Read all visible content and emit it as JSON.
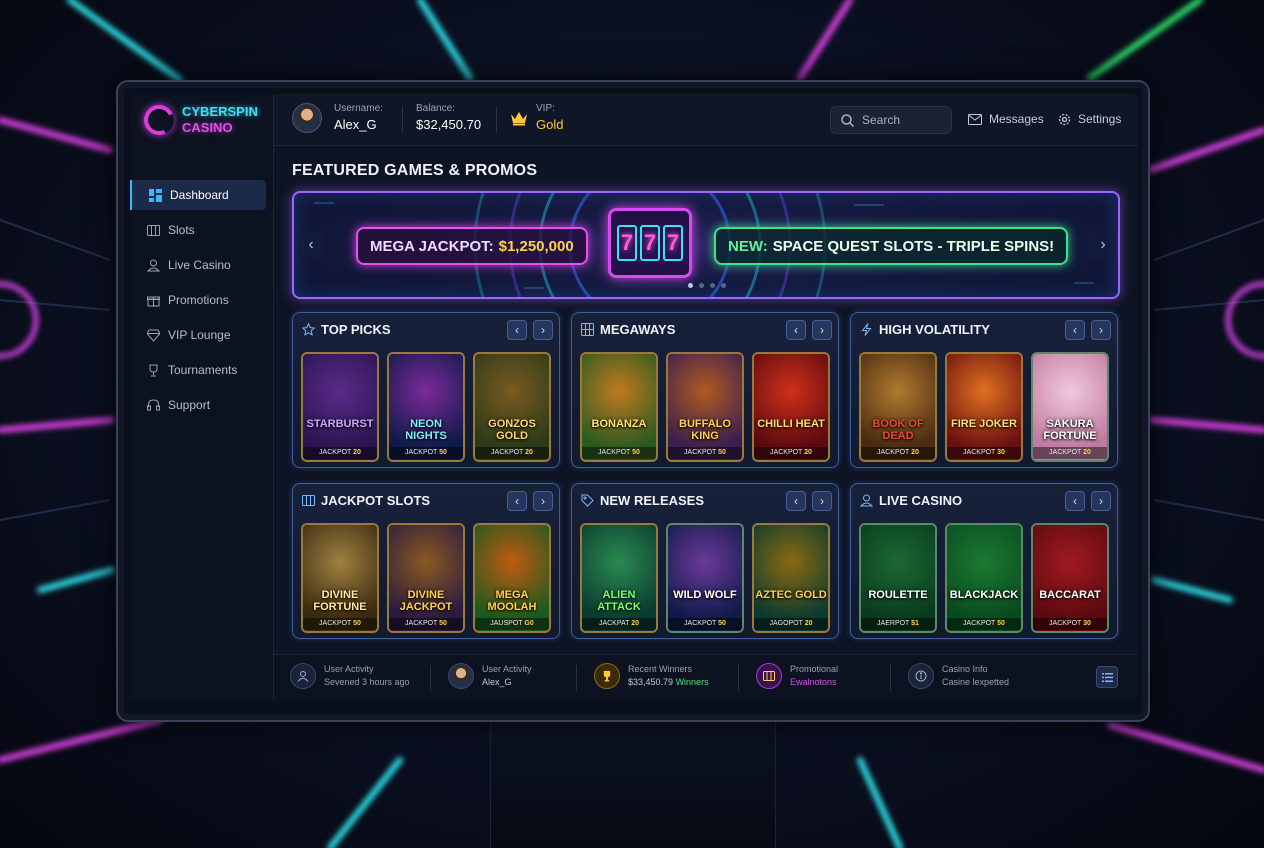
{
  "brand": {
    "line1": "CYBERSPIN",
    "line2": "CASINO"
  },
  "header": {
    "username_label": "Username:",
    "username": "Alex_G",
    "balance_label": "Balance:",
    "balance": "$32,450.70",
    "vip_label": "VIP:",
    "vip_level": "Gold",
    "search_placeholder": "Search",
    "messages_label": "Messages",
    "settings_label": "Settings"
  },
  "sidebar": {
    "items": [
      {
        "label": "Dashboard",
        "icon": "grid-icon",
        "active": true
      },
      {
        "label": "Slots",
        "icon": "slot-machine-icon"
      },
      {
        "label": "Live Casino",
        "icon": "dealer-icon"
      },
      {
        "label": "Promotions",
        "icon": "gift-icon"
      },
      {
        "label": "VIP Lounge",
        "icon": "diamond-icon"
      },
      {
        "label": "Tournaments",
        "icon": "trophy-icon"
      },
      {
        "label": "Support",
        "icon": "headset-icon"
      }
    ]
  },
  "featured": {
    "title": "FEATURED GAMES & PROMOS",
    "promo1_text": "MEGA JACKPOT:",
    "promo1_amount": "$1,250,000",
    "promo2_prefix": "NEW:",
    "promo2_text": "SPACE QUEST SLOTS - TRIPLE SPINS!",
    "slot_digits": [
      "7",
      "7",
      "7"
    ]
  },
  "panels": [
    {
      "title": "TOP PICKS",
      "icon": "star-icon",
      "games": [
        {
          "name": "STARBURST",
          "jackpot_label": "JACKPOT",
          "jackpot": "20",
          "colors": [
            "#2a1550",
            "#5a2a8a"
          ],
          "title_color": "#c8a8ff"
        },
        {
          "name": "NEON NIGHTS",
          "jackpot_label": "JACKPOT",
          "jackpot": "50",
          "colors": [
            "#101a48",
            "#7a2a9a"
          ],
          "title_color": "#7ef0ff"
        },
        {
          "name": "GONZOS GOLD",
          "jackpot_label": "JACKPOT",
          "jackpot": "20",
          "colors": [
            "#2a3a18",
            "#7a5a20"
          ],
          "title_color": "#ffd86a"
        }
      ]
    },
    {
      "title": "MEGAWAYS",
      "icon": "grid-icon",
      "games": [
        {
          "name": "BONANZA",
          "jackpot_label": "JACKPOT",
          "jackpot": "50",
          "colors": [
            "#2a5a20",
            "#c07a20"
          ],
          "title_color": "#ffe070"
        },
        {
          "name": "BUFFALO KING",
          "jackpot_label": "JACKPOT",
          "jackpot": "50",
          "colors": [
            "#3a1e50",
            "#b05a20"
          ],
          "title_color": "#ffd24a"
        },
        {
          "name": "CHILLI HEAT",
          "jackpot_label": "JACKPOT",
          "jackpot": "20",
          "colors": [
            "#5a0a10",
            "#d03018"
          ],
          "title_color": "#ffe070"
        }
      ]
    },
    {
      "title": "HIGH VOLATILITY",
      "icon": "lightning-icon",
      "games": [
        {
          "name": "BOOK OF DEAD",
          "jackpot_label": "JACKPOT",
          "jackpot": "20",
          "colors": [
            "#4a2a10",
            "#b07a30"
          ],
          "title_color": "#e84a3a"
        },
        {
          "name": "FIRE JOKER",
          "jackpot_label": "JACKPOT",
          "jackpot": "30",
          "colors": [
            "#6a1010",
            "#e07020"
          ],
          "title_color": "#ffe070"
        },
        {
          "name": "SAKURA FORTUNE",
          "jackpot_label": "JACKPOT",
          "jackpot": "20",
          "colors": [
            "#c07aa0",
            "#f0c8dc"
          ],
          "title_color": "#ffffff"
        }
      ]
    },
    {
      "title": "JACKPOT SLOTS",
      "icon": "slot-machine-icon",
      "games": [
        {
          "name": "DIVINE FORTUNE",
          "jackpot_label": "JACKPOT",
          "jackpot": "50",
          "colors": [
            "#3a2a10",
            "#a08040"
          ],
          "title_color": "#ffe8a0"
        },
        {
          "name": "DIVINE JACKPOT",
          "jackpot_label": "JACKPOT",
          "jackpot": "50",
          "colors": [
            "#2a1a40",
            "#8a5a20"
          ],
          "title_color": "#ffd24a"
        },
        {
          "name": "MEGA MOOLAH",
          "jackpot_label": "JAUSPOT",
          "jackpot": "G0",
          "colors": [
            "#1a5a20",
            "#c05a10"
          ],
          "title_color": "#ffd24a"
        }
      ]
    },
    {
      "title": "NEW RELEASES",
      "icon": "tag-icon",
      "games": [
        {
          "name": "ALIEN ATTACK",
          "jackpot_label": "JACKPAT",
          "jackpot": "20",
          "colors": [
            "#0a3a30",
            "#2a8a50"
          ],
          "title_color": "#7aff6a"
        },
        {
          "name": "WILD WOLF",
          "jackpot_label": "JACKPOT",
          "jackpot": "50",
          "colors": [
            "#101a48",
            "#6a3a9a"
          ],
          "title_color": "#ffffff"
        },
        {
          "name": "AZTEC GOLD",
          "jackpot_label": "JAGOPOT",
          "jackpot": "20",
          "colors": [
            "#0a3a30",
            "#8a6a10"
          ],
          "title_color": "#ffd24a"
        }
      ]
    },
    {
      "title": "LIVE CASINO",
      "icon": "dealer-icon",
      "games": [
        {
          "name": "ROULETTE",
          "jackpot_label": "JAERPOT",
          "jackpot": "$1",
          "colors": [
            "#0a3a20",
            "#1a6a30"
          ],
          "title_color": "#ffffff"
        },
        {
          "name": "BLACKJACK",
          "jackpot_label": "JACKPOT",
          "jackpot": "50",
          "colors": [
            "#0a4a20",
            "#1a7a30"
          ],
          "title_color": "#ffffff"
        },
        {
          "name": "BACCARAT",
          "jackpot_label": "JACKPOT",
          "jackpot": "30",
          "colors": [
            "#5a0a10",
            "#a01a20"
          ],
          "title_color": "#ffffff"
        }
      ]
    }
  ],
  "footer": [
    {
      "title": "User Activity",
      "sub": "Sevened 3 hours ago",
      "icon": "user-icon"
    },
    {
      "title": "User Activity",
      "sub": "Alex_G",
      "icon": "avatar-icon"
    },
    {
      "title": "Recent Winners",
      "sub": "$33,450.79",
      "sub2": "Winners",
      "icon": "trophy-icon"
    },
    {
      "title": "Promotional",
      "sub": "Ewalnotons",
      "icon": "slot-machine-icon"
    },
    {
      "title": "Casino Info",
      "sub": "Casine lexpetted",
      "icon": "info-icon"
    }
  ],
  "colors": {
    "accent": "#3ab6ff",
    "neon_pink": "#e04fe8",
    "neon_green": "#3fe28a",
    "gold": "#ffd24a"
  }
}
